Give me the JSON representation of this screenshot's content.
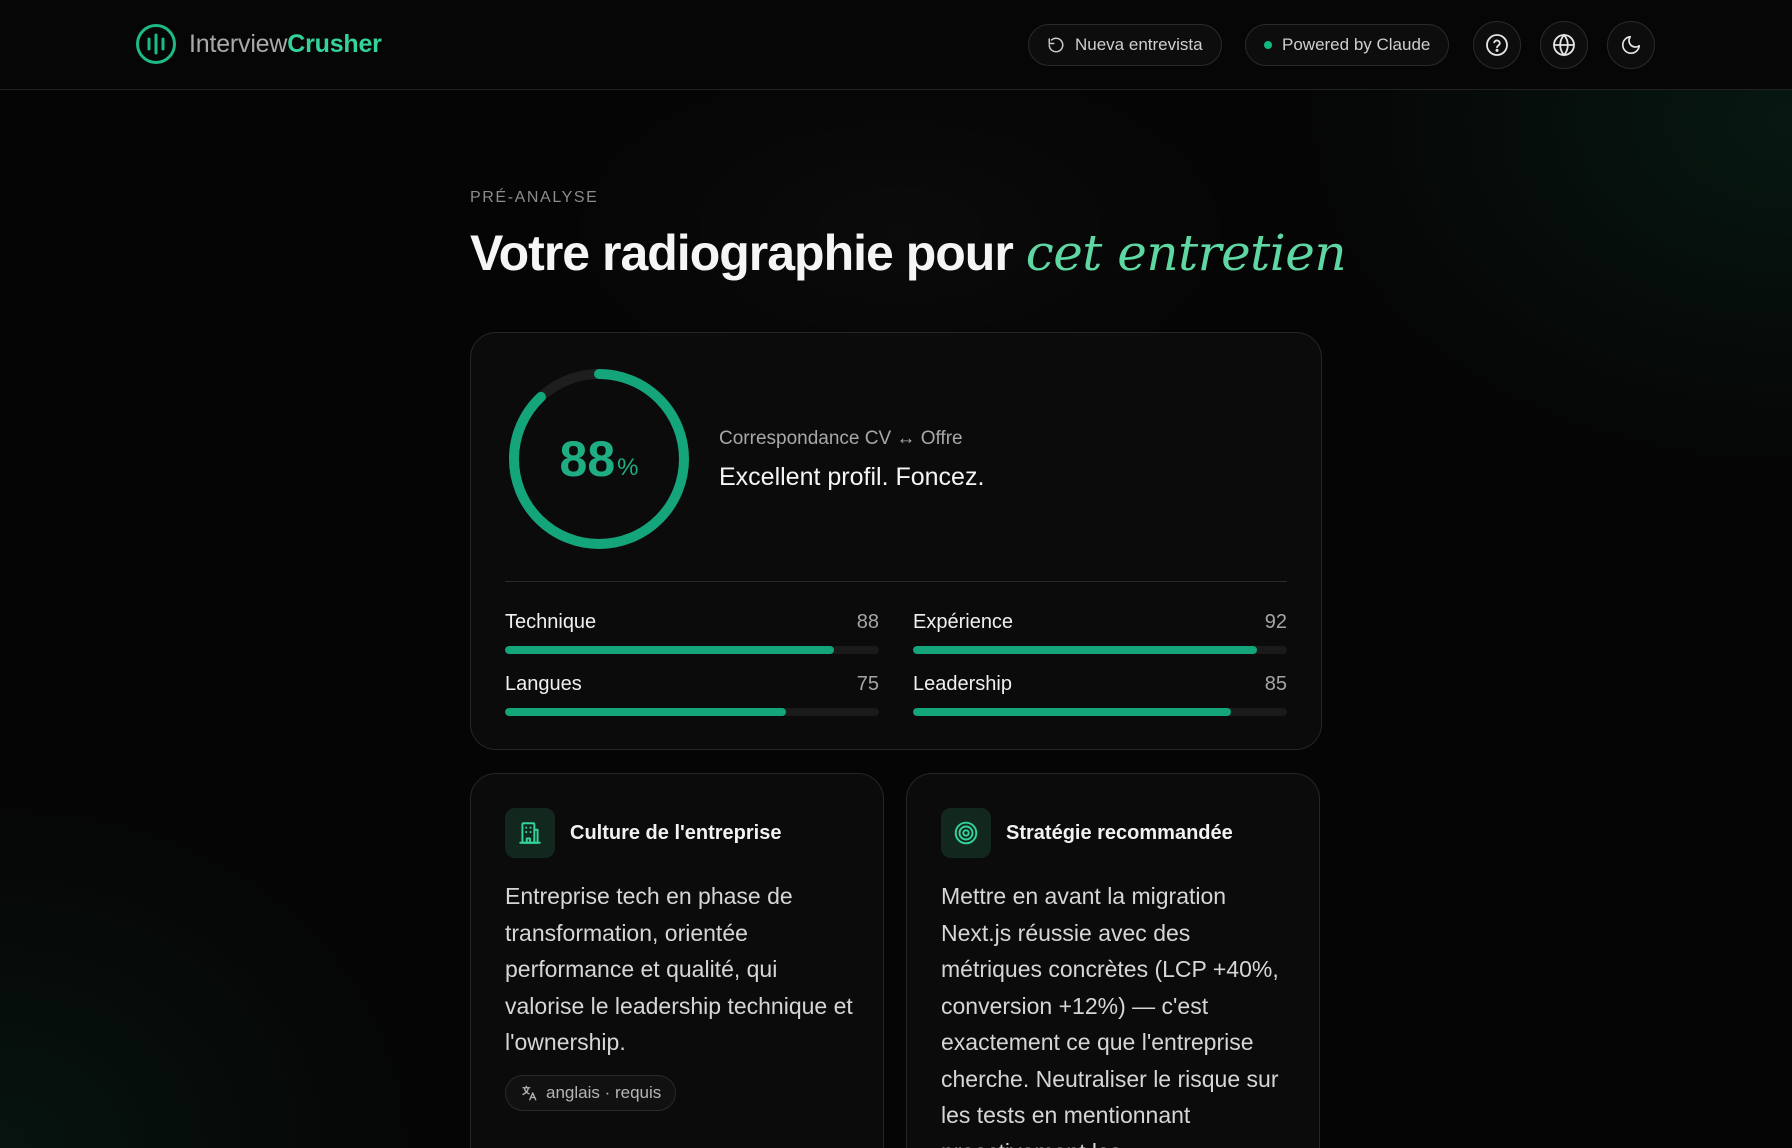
{
  "header": {
    "brand_a": "Interview",
    "brand_b": "Crusher",
    "new_interview_label": "Nueva entrevista",
    "powered_label": "Powered by Claude"
  },
  "main": {
    "eyebrow": "PRÉ-ANALYSE",
    "title_plain": "Votre radiographie pour",
    "title_emphasis": "cet entretien"
  },
  "score": {
    "value": "88",
    "unit": "%",
    "fraction": 0.88,
    "label": "Correspondance CV ↔ Offre",
    "verdict": "Excellent profil. Foncez."
  },
  "metrics": [
    {
      "label": "Technique",
      "value": "88",
      "fraction": 0.88
    },
    {
      "label": "Expérience",
      "value": "92",
      "fraction": 0.92
    },
    {
      "label": "Langues",
      "value": "75",
      "fraction": 0.75
    },
    {
      "label": "Leadership",
      "value": "85",
      "fraction": 0.85
    }
  ],
  "culture": {
    "title": "Culture de l'entreprise",
    "body": "Entreprise tech en phase de transformation, orientée performance et qualité, qui valorise le leadership technique et l'ownership.",
    "chip": "anglais · requis",
    "icon": "building-icon"
  },
  "strategy": {
    "title": "Stratégie recommandée",
    "body": "Mettre en avant la migration Next.js réussie avec des métriques concrètes (LCP +40%, conversion +12%) — c'est exactement ce que l'entreprise cherche. Neutraliser le risque sur les tests en mentionnant proactivement les",
    "icon": "target-icon"
  },
  "colors": {
    "accent": "#10b981",
    "accent_text": "#34d399",
    "background": "#050505"
  }
}
